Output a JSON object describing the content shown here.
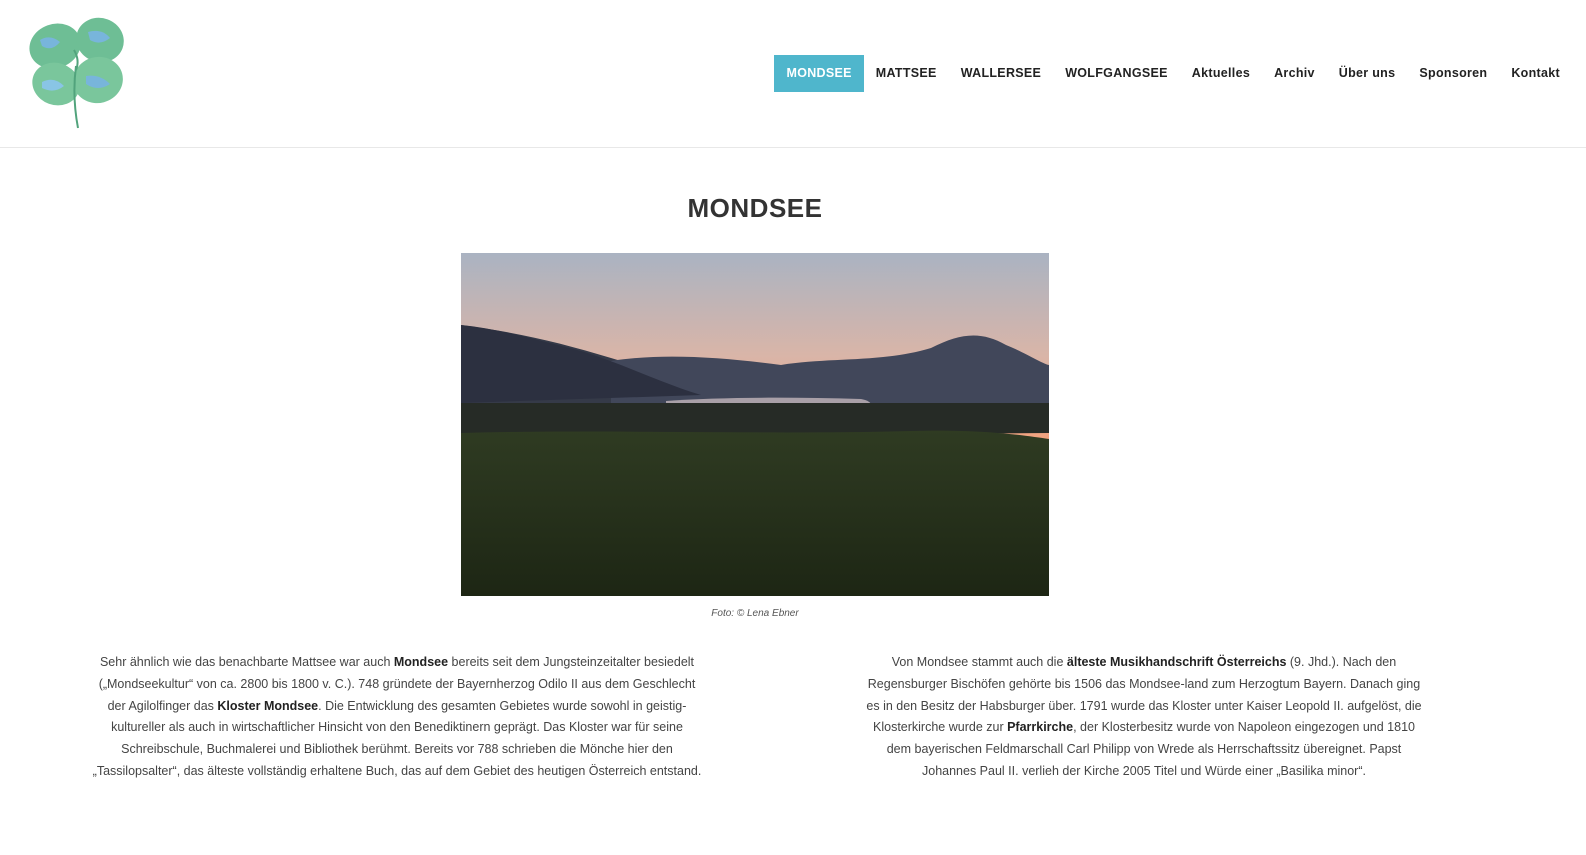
{
  "logo": {
    "icon": "four-leaf-clover-icon",
    "colors": {
      "leaf": "#5fb88a",
      "water": "#6aaed8"
    }
  },
  "nav": {
    "items": [
      {
        "label": "MONDSEE",
        "active": true
      },
      {
        "label": "MATTSEE"
      },
      {
        "label": "WALLERSEE"
      },
      {
        "label": "WOLFGANGSEE"
      },
      {
        "label": "Aktuelles"
      },
      {
        "label": "Archiv"
      },
      {
        "label": "Über uns"
      },
      {
        "label": "Sponsoren"
      },
      {
        "label": "Kontakt"
      }
    ],
    "accent": "#4fb6cc"
  },
  "page": {
    "title": "MONDSEE",
    "photo_caption": "Foto: © Lena Ebner"
  },
  "left_text": {
    "t1": "Sehr ähnlich wie das benachbarte Mattsee war auch ",
    "b1": "Mondsee",
    "t2": " bereits seit dem Jungsteinzeitalter besiedelt („Mondseekultur“ von ca. 2800 bis 1800 v. C.). 748 gründete der Bayernherzog Odilo II aus dem Geschlecht der Agilolfinger das ",
    "b2": "Kloster Mondsee",
    "t3": ". Die Entwicklung des gesamten Gebietes wurde sowohl in geistig-kultureller als auch in wirtschaftlicher Hinsicht von den Benediktinern geprägt. Das Kloster war für seine Schreibschule, Buchmalerei und Bibliothek berühmt. Bereits vor 788 schrieben die Mönche hier den „Tassilopsalter“, das älteste vollständig erhaltene Buch, das auf dem Gebiet des heutigen Österreich entstand."
  },
  "right_text": {
    "t1": "Von Mondsee stammt auch die ",
    "b1": "älteste Musikhandschrift Österreichs",
    "t2": " (9. Jhd.). Nach den Regensburger Bischöfen gehörte bis 1506 das Mondsee-land zum Herzogtum Bayern. Danach ging es in den Besitz der Habsburger über. 1791 wurde das Kloster unter Kaiser Leopold II. aufgelöst, die Klosterkirche wurde zur ",
    "b2": "Pfarrkirche",
    "t3": ", der Klosterbesitz wurde von Napoleon eingezogen und 1810 dem bayerischen Feldmarschall Carl Philipp von Wrede als Herrschaftssitz übereignet. Papst Johannes Paul II. verlieh der Kirche 2005 Titel und Würde einer „Basilika minor“."
  }
}
